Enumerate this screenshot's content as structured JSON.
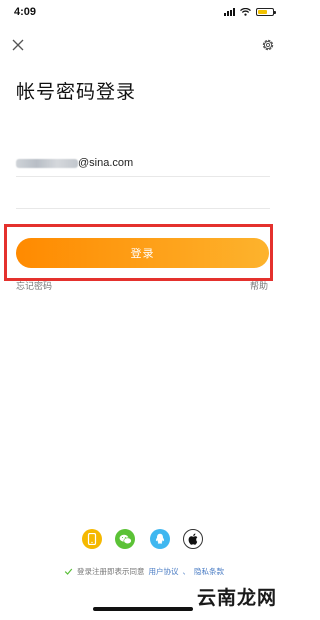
{
  "status_bar": {
    "time": "4:09",
    "battery_color": "#f2c200",
    "battery_level": 0.5
  },
  "header": {
    "close_icon": "close-icon",
    "settings_icon": "gear-icon"
  },
  "title": "帐号密码登录",
  "form": {
    "account_value_suffix": "@sina.com",
    "account_masked": true,
    "password_value": "",
    "login_button_label": "登录",
    "forgot_password_label": "忘记密码",
    "help_label": "帮助"
  },
  "colors": {
    "button_start": "#ff8a00",
    "button_end": "#fdb32d",
    "highlight": "#e4312d",
    "link": "#4a7cc4"
  },
  "social_logins": [
    {
      "icon": "phone-icon",
      "color": "#f5b800"
    },
    {
      "icon": "wechat-icon",
      "color": "#5bc236"
    },
    {
      "icon": "qq-icon",
      "color": "#3fb7f0"
    },
    {
      "icon": "apple-icon",
      "color": "#111111"
    }
  ],
  "agreement": {
    "prefix": "登录注册即表示同意",
    "user_agreement": "用户协议",
    "separator": "、",
    "privacy": "隐私条款"
  },
  "watermark": "云南龙网"
}
